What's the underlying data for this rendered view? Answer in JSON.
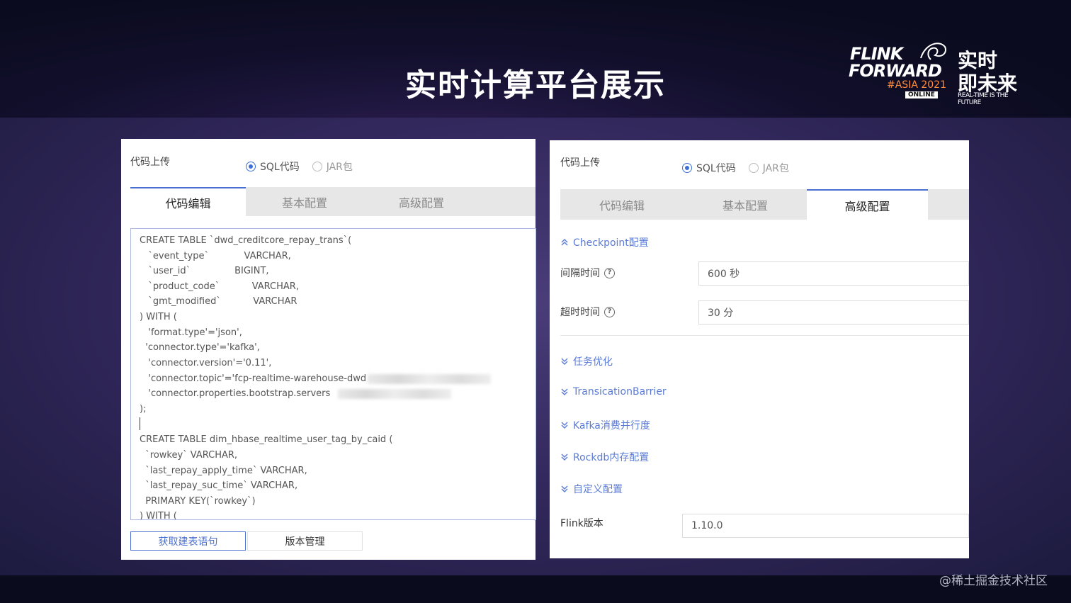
{
  "slide": {
    "title": "实时计算平台展示",
    "watermark": "@稀土掘金技术社区"
  },
  "logo": {
    "line1": "FLINK",
    "line2": "FORWARD",
    "line3": "#ASIA 2021",
    "line4": "ONLINE",
    "cn1": "实时",
    "cn2": "即未来",
    "tagline": "REAL-TIME IS THE FUTURE"
  },
  "left": {
    "upload_label": "代码上传",
    "radio_sql": "SQL代码",
    "radio_jar": "JAR包",
    "tabs": [
      "代码编辑",
      "基本配置",
      "高级配置"
    ],
    "code": [
      "CREATE TABLE `dwd_creditcore_repay_trans`(",
      "   `event_type`            VARCHAR,",
      "   `user_id`               BIGINT,",
      "   `product_code`           VARCHAR,",
      "   `gmt_modified`           VARCHAR",
      ") WITH (",
      "   'format.type'='json',",
      "  'connector.type'='kafka',",
      "   'connector.version'='0.11',",
      "   'connector.topic'='fcp-realtime-warehouse-dwd",
      "   'connector.properties.bootstrap.servers",
      ");",
      "",
      "CREATE TABLE dim_hbase_realtime_user_tag_by_caid (",
      "  `rowkey` VARCHAR,",
      "  `last_repay_apply_time` VARCHAR,",
      "  `last_repay_suc_time` VARCHAR,",
      "  PRIMARY KEY(`rowkey`)",
      ") WITH ("
    ],
    "btn_get_ddl": "获取建表语句",
    "btn_version": "版本管理"
  },
  "right": {
    "upload_label": "代码上传",
    "radio_sql": "SQL代码",
    "radio_jar": "JAR包",
    "tabs": [
      "代码编辑",
      "基本配置",
      "高级配置"
    ],
    "checkpoint_head": "Checkpoint配置",
    "interval_label": "间隔时间",
    "interval_value": "600 秒",
    "timeout_label": "超时时间",
    "timeout_value": "30 分",
    "sections": [
      "任务优化",
      "TransicationBarrier",
      "Kafka消费并行度",
      "Rockdb内存配置",
      "自定义配置"
    ],
    "flink_label": "Flink版本",
    "flink_value": "1.10.0"
  },
  "colors": {
    "accent": "#4a6fd0",
    "link": "#5b7bd5",
    "title": "#ffffff"
  }
}
